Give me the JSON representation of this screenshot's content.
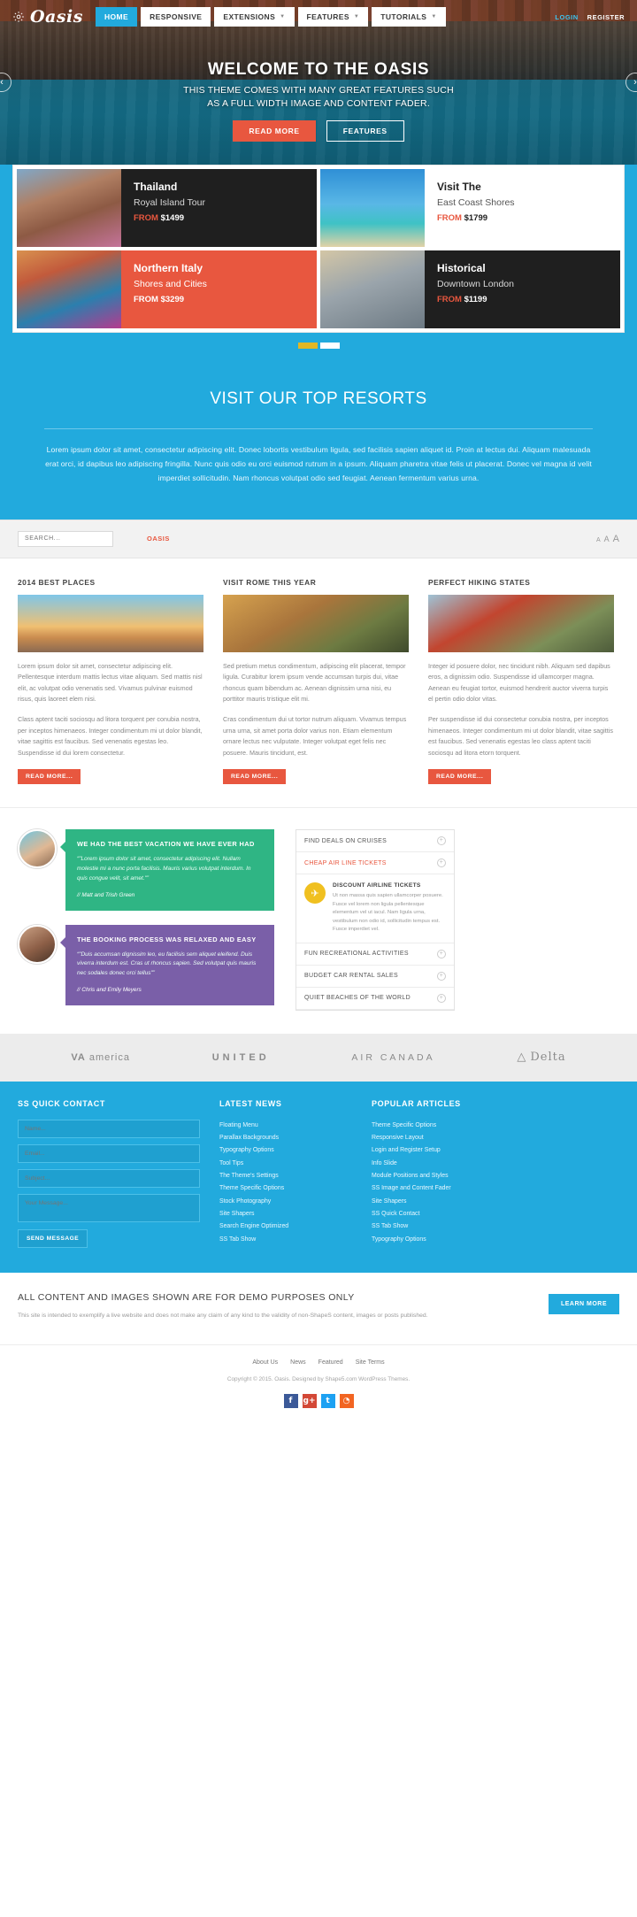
{
  "nav": {
    "brand": "Oasis",
    "gear_icon": "gear-icon",
    "items": [
      {
        "label": "HOME",
        "active": true,
        "caret": false
      },
      {
        "label": "RESPONSIVE",
        "active": false,
        "caret": false
      },
      {
        "label": "EXTENSIONS",
        "active": false,
        "caret": true
      },
      {
        "label": "FEATURES",
        "active": false,
        "caret": true
      },
      {
        "label": "TUTORIALS",
        "active": false,
        "caret": true
      }
    ],
    "login": "LOGIN",
    "register": "REGISTER",
    "caret_glyph": "▼"
  },
  "hero": {
    "title": "WELCOME TO THE OASIS",
    "line1": "THIS THEME COMES WITH MANY GREAT FEATURES SUCH",
    "line2": "AS A FULL WIDTH IMAGE AND CONTENT FADER.",
    "btn_primary": "READ MORE",
    "btn_secondary": "FEATURES",
    "arrow_left": "‹",
    "arrow_right": "›"
  },
  "tiles": [
    {
      "title": "Thailand",
      "subtitle": "Royal Island Tour",
      "from": "FROM",
      "price": "$1499",
      "style": "dark",
      "pic": "p-bike"
    },
    {
      "title": "Visit The",
      "subtitle": "East Coast Shores",
      "from": "FROM",
      "price": "$1799",
      "style": "light",
      "pic": "p-beach"
    },
    {
      "title": "Northern Italy",
      "subtitle": "Shores and Cities",
      "from": "FROM",
      "price": "$3299",
      "style": "orange",
      "pic": "p-italy"
    },
    {
      "title": "Historical",
      "subtitle": "Downtown London",
      "from": "FROM",
      "price": "$1199",
      "style": "dark",
      "pic": "p-london"
    }
  ],
  "slider_dots": 2,
  "resorts": {
    "heading": "VISIT OUR TOP RESORTS",
    "paragraph": "Lorem ipsum dolor sit amet, consectetur adipiscing elit. Donec lobortis vestibulum ligula, sed facilisis sapien aliquet id. Proin at lectus dui. Aliquam malesuada erat orci, id dapibus leo adipiscing fringilla. Nunc quis odio eu orci euismod rutrum in a ipsum. Aliquam pharetra vitae felis ut placerat. Donec vel magna id velit imperdiet sollicitudin. Nam rhoncus volutpat odio sed feugiat. Aenean fermentum varius urna."
  },
  "searchbar": {
    "placeholder": "SEARCH...",
    "value": "",
    "oasis_link": "OASIS",
    "font_small": "A",
    "font_medium": "A",
    "font_large": "A"
  },
  "blog": [
    {
      "heading": "2014 BEST PLACES",
      "thumb": "t-sunset",
      "p1": "Lorem ipsum dolor sit amet, consectetur adipiscing elit. Pellentesque interdum mattis lectus vitae aliquam. Sed mattis nisl elit, ac volutpat odio venenatis sed. Vivamus pulvinar euismod risus, quis laoreet elem nisi.",
      "p2": "Class aptent taciti sociosqu ad litora torquent per conubia nostra, per inceptos himenaeos. Integer condimentum mi ut dolor blandit, vitae sagittis est faucibus. Sed venenatis egestas leo. Suspendisse id dui lorem consectetur.",
      "btn": "READ MORE..."
    },
    {
      "heading": "VISIT ROME THIS YEAR",
      "thumb": "t-rome",
      "p1": "Sed pretium metus condimentum, adipiscing elit placerat, tempor ligula. Curabitur lorem ipsum vende accumsan turpis dui, vitae rhoncus quam bibendum ac. Aenean dignissim urna nisi, eu porttitor mauris tristique elit mi.",
      "p2": "Cras condimentum dui ut tortor nutrum aliquam. Vivamus tempus urna urna, sit amet porta dolor varius non. Etiam elementum ornare lectus nec vulputate. Integer volutpat eget felis nec posuere. Mauris tincidunt, est.",
      "btn": "READ MORE..."
    },
    {
      "heading": "PERFECT HIKING STATES",
      "thumb": "t-hike",
      "p1": "Integer id posuere dolor, nec tincidunt nibh. Aliquam sed dapibus eros, a dignissim odio. Suspendisse id ullamcorper magna. Aenean eu feugiat tortor, euismod hendrerit auctor viverra turpis el pertin odio dolor vitas.",
      "p2": "Per suspendisse id dui consectetur conubia nostra, per inceptos himenaeos. Integer condimentum mi ut dolor blandit, vitae sagittis est faucibus. Sed venenatis egestas leo class aptent taciti sociosqu ad litora etorn torquent.",
      "btn": "READ MORE..."
    }
  ],
  "testimonials": [
    {
      "avatar": "a1",
      "title": "WE HAD THE BEST VACATION WE HAVE EVER HAD",
      "quote": "\"Lorem ipsum dolor sit amet, consectetur adipiscing elit. Nullam molestie mi a nunc porta facilisis. Mauris varius volutpat interdum. In quis congue velit, sit amet.\"",
      "who": "// Matt and Trish Green",
      "color": "green"
    },
    {
      "avatar": "a2",
      "title": "THE BOOKING PROCESS WAS RELAXED AND EASY",
      "quote": "\"Duis accumsan dignissim leo, eu facilisis sem aliquet eleifend. Duis viverra interdum est. Cras ut rhoncus sapien. Sed volutpat quis mauris nec sodales donec orci tellus\"",
      "who": "// Chris and Emily Meyers",
      "color": "purple"
    }
  ],
  "accordion": {
    "items": [
      {
        "label": "FIND DEALS ON CRUISES",
        "open": false
      },
      {
        "label": "CHEAP AIR LINE TICKETS",
        "open": true
      },
      {
        "label": "FUN RECREATIONAL ACTIVITIES",
        "open": false
      },
      {
        "label": "BUDGET CAR RENTAL SALES",
        "open": false
      },
      {
        "label": "QUIET BEACHES OF THE WORLD",
        "open": false
      }
    ],
    "plus_glyph": "+",
    "panel": {
      "badge_icon": "plane-icon",
      "badge_glyph": "✈",
      "title": "DISCOUNT AIRLINE TICKETS",
      "text": "Ut non massa quis sapien ullamcorper posuere. Fusce vel lorem non ligula pellentesque elementum vel ut iacul. Nam ligula urna, vestibulum non odio id, sollicitudin tempus est. Fusce imperdiet vel."
    }
  },
  "logos": [
    {
      "name": "virgin-america-logo",
      "text": "america",
      "prefix": "VA"
    },
    {
      "name": "united-logo",
      "text": "UNITED",
      "prefix": ""
    },
    {
      "name": "air-canada-logo",
      "text": "AIR CANADA",
      "prefix": ""
    },
    {
      "name": "delta-logo",
      "text": "Delta",
      "prefix": "△"
    }
  ],
  "footer": {
    "contact": {
      "title": "SS QUICK CONTACT",
      "name_placeholder": "Name...",
      "email_placeholder": "Email...",
      "subject_placeholder": "Subject...",
      "message_placeholder": "Your Message...",
      "send_label": "SEND MESSAGE"
    },
    "news": {
      "title": "LATEST NEWS",
      "links": [
        "Floating Menu",
        "Parallax Backgrounds",
        "Typography Options",
        "Tool Tips",
        "The Theme's Settings",
        "Theme Specific Options",
        "Stock Photography",
        "Site Shapers",
        "Search Engine Optimized",
        "SS Tab Show"
      ]
    },
    "articles": {
      "title": "POPULAR ARTICLES",
      "links": [
        "Theme Specific Options",
        "Responsive Layout",
        "Login and Register Setup",
        "Info Slide",
        "Module Positions and Styles",
        "SS Image and Content Fader",
        "Site Shapers",
        "SS Quick Contact",
        "SS Tab Show",
        "Typography Options"
      ]
    }
  },
  "cta": {
    "heading": "ALL CONTENT AND IMAGES SHOWN ARE FOR DEMO PURPOSES ONLY",
    "text": "This site is intended to exemplify a live website and does not make any claim of any kind to the validity of non-ShapeS content, images or posts published.",
    "button": "LEARN MORE"
  },
  "bottom": {
    "links": [
      "About Us",
      "News",
      "Featured",
      "Site Terms"
    ],
    "copyright": "Copyright © 2015. Oasis. Designed by Shape5.com WordPress Themes.",
    "socials": [
      {
        "name": "facebook-icon",
        "glyph": "f",
        "cls": "fb"
      },
      {
        "name": "google-plus-icon",
        "glyph": "g+",
        "cls": "gp"
      },
      {
        "name": "twitter-icon",
        "glyph": "t",
        "cls": "tw"
      },
      {
        "name": "rss-icon",
        "glyph": "◔",
        "cls": "rss"
      }
    ]
  }
}
